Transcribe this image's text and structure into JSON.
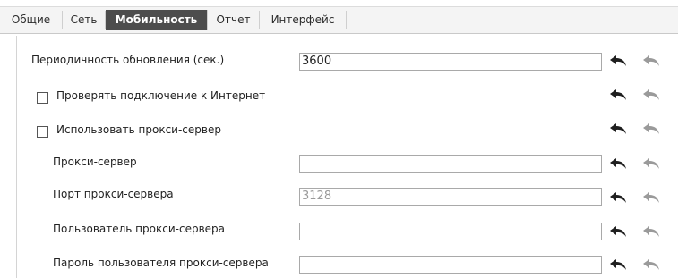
{
  "tabs": [
    {
      "label": "Общие"
    },
    {
      "label": "Сеть"
    },
    {
      "label": "Мобильность",
      "active": true
    },
    {
      "label": "Отчет"
    },
    {
      "label": "Интерфейс"
    }
  ],
  "settings": {
    "update_period": {
      "label": "Периодичность обновления (сек.)",
      "value": "3600"
    },
    "check_internet": {
      "label": "Проверять подключение к Интернет",
      "checked": false
    },
    "use_proxy": {
      "label": "Использовать прокси-сервер",
      "checked": false
    },
    "proxy_server": {
      "label": "Прокси-сервер",
      "value": ""
    },
    "proxy_port": {
      "label": "Порт прокси-сервера",
      "value": "3128"
    },
    "proxy_user": {
      "label": "Пользователь прокси-сервера",
      "value": ""
    },
    "proxy_password": {
      "label": "Пароль пользователя прокси-сервера",
      "value": ""
    }
  },
  "icons": {
    "reset": "undo-arrow-icon",
    "reset_default": "undo-arrow-faded-icon"
  },
  "colors": {
    "active_tab": "#4d4d4d",
    "reset_icon": "#1f1f1f",
    "reset_default_icon": "#9a9a9a"
  }
}
